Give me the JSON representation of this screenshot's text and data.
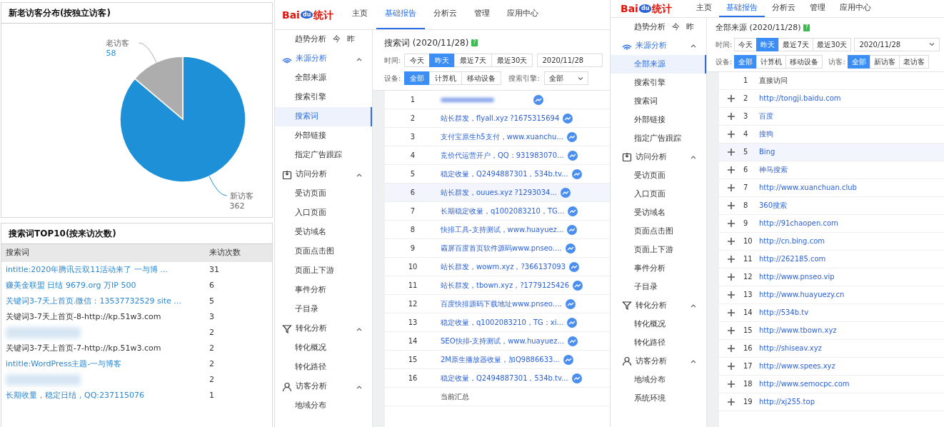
{
  "visitor_share": {
    "title": "新老访客分布(按独立访客)",
    "chart_data": {
      "type": "pie",
      "categories": [
        "老访客",
        "新访客"
      ],
      "values": [
        58,
        362
      ],
      "data_labels": true
    }
  },
  "keyword_top10": {
    "title": "搜索词TOP10(按来访次数)",
    "columns": [
      "搜索词",
      "来访次数"
    ],
    "rows": [
      {
        "kind": "link",
        "keyword": "intitle:2020年腾讯云双11活动来了 一与博 ...",
        "visits": "31"
      },
      {
        "kind": "link",
        "keyword": "赚美金联盟 日结 9679.org 万IP 500",
        "visits": "6"
      },
      {
        "kind": "link",
        "keyword": "关键词3-7天上首页.微信：13537732529 site ...",
        "visits": "5"
      },
      {
        "kind": "text",
        "keyword": "关键词3-7天上首页-8-http://kp.51w3.com",
        "visits": "3"
      },
      {
        "kind": "blurred",
        "visits": "2"
      },
      {
        "kind": "text",
        "keyword": "关键词3-7天上首页-7-http://kp.51w3.com",
        "visits": "2"
      },
      {
        "kind": "link",
        "keyword": "intitle:WordPress主题-一与博客",
        "visits": "2"
      },
      {
        "kind": "blurred",
        "visits": "2"
      },
      {
        "kind": "link",
        "keyword": "长期收量，稳定日结，QQ:237115076",
        "visits": "1"
      }
    ]
  },
  "reports": [
    {
      "logo": {
        "left": "Bai",
        "paw": "du",
        "right": "统计"
      },
      "nav": [
        {
          "label": "主页",
          "selected": false
        },
        {
          "label": "基础报告",
          "selected": true
        },
        {
          "label": "分析云",
          "selected": false
        },
        {
          "label": "管理",
          "selected": false
        },
        {
          "label": "应用中心",
          "selected": false
        }
      ],
      "sidebar": [
        {
          "kind": "link",
          "label": "趋势分析",
          "shortcuts": [
            "今",
            "昨"
          ]
        },
        {
          "kind": "section",
          "label": "来源分析",
          "expanded": true,
          "children": [
            {
              "label": "全部来源",
              "selected": false
            },
            {
              "label": "搜索引擎",
              "selected": false
            },
            {
              "label": "搜索词",
              "selected": true
            },
            {
              "label": "外部链接",
              "selected": false
            },
            {
              "label": "指定广告跟踪",
              "selected": false
            }
          ]
        },
        {
          "kind": "section",
          "label": "访问分析",
          "expanded": true,
          "children": [
            {
              "label": "受访页面",
              "selected": false
            },
            {
              "label": "入口页面",
              "selected": false
            },
            {
              "label": "受访域名",
              "selected": false
            },
            {
              "label": "页面点击图",
              "selected": false
            },
            {
              "label": "页面上下游",
              "selected": false
            },
            {
              "label": "事件分析",
              "selected": false
            },
            {
              "label": "子目录",
              "selected": false
            }
          ]
        },
        {
          "kind": "section",
          "label": "转化分析",
          "expanded": true,
          "children": [
            {
              "label": "转化概况",
              "selected": false
            },
            {
              "label": "转化路径",
              "selected": false
            }
          ]
        },
        {
          "kind": "section",
          "label": "访客分析",
          "expanded": true,
          "children": [
            {
              "label": "地域分布",
              "selected": false
            }
          ]
        }
      ],
      "title": "搜索词",
      "date": "(2020/11/28)",
      "help_mark": "?",
      "filters": [
        {
          "label": "时间:",
          "controls": [
            {
              "kind": "buttons",
              "options": [
                {
                  "label": "今天",
                  "selected": false
                },
                {
                  "label": "昨天",
                  "selected": true
                },
                {
                  "label": "最近7天",
                  "selected": false
                },
                {
                  "label": "最近30天",
                  "selected": false
                }
              ]
            },
            {
              "kind": "date",
              "value": "2020/11/28",
              "dropdown": false
            }
          ]
        },
        {
          "label": "设备:",
          "controls": [
            {
              "kind": "buttons",
              "options": [
                {
                  "label": "全部",
                  "selected": true
                },
                {
                  "label": "计算机",
                  "selected": false
                },
                {
                  "label": "移动设备",
                  "selected": false
                }
              ]
            },
            {
              "kind": "select",
              "label": "搜索引擎:",
              "value": "全部"
            }
          ]
        }
      ],
      "table": {
        "trend_icons": true,
        "summary": "当前汇总",
        "rows": [
          {
            "index": "1",
            "kind": "blurred",
            "hovered": false
          },
          {
            "index": "2",
            "kind": "link",
            "text": "站长群发，flyall.xyz ?1675315694",
            "hovered": false
          },
          {
            "index": "3",
            "kind": "link",
            "text": "支付宝原生h5支付，www.xuanchu...",
            "hovered": false
          },
          {
            "index": "4",
            "kind": "link",
            "text": "竞价代运营开户，QQ：931983070...",
            "hovered": false
          },
          {
            "index": "5",
            "kind": "link",
            "text": "稳定收量，Q2494887301，534b.tv...",
            "hovered": false
          },
          {
            "index": "6",
            "kind": "link",
            "text": "站长群发，ouues.xyz ?1293034...",
            "hovered": true
          },
          {
            "index": "7",
            "kind": "link",
            "text": "长期稳定收量，q1002083210，TG...",
            "hovered": false
          },
          {
            "index": "8",
            "kind": "link",
            "text": "快排工具-支持测试，www.huayuez...",
            "hovered": false
          },
          {
            "index": "9",
            "kind": "link",
            "text": "霸屏百度首页软件源码www.pnseo....",
            "hovered": false
          },
          {
            "index": "10",
            "kind": "link",
            "text": "站长群发，wowm.xyz，?366137093",
            "hovered": false
          },
          {
            "index": "11",
            "kind": "link",
            "text": "站长群发，tbown.xyz，?1779125426",
            "hovered": false
          },
          {
            "index": "12",
            "kind": "link",
            "text": "百度快排源码下载地址www.pnseo....",
            "hovered": false
          },
          {
            "index": "13",
            "kind": "link",
            "text": "稳定收量，q1002083210，TG：xi...",
            "hovered": false
          },
          {
            "index": "14",
            "kind": "link",
            "text": "SEO快排-支持测试，www.huayuez...",
            "hovered": false
          },
          {
            "index": "15",
            "kind": "link",
            "text": "2M原生播放器收量，加Q9886633...",
            "hovered": false
          },
          {
            "index": "16",
            "kind": "link",
            "text": "稳定收量，Q2494887301，534b.tv...",
            "hovered": false
          }
        ]
      }
    },
    {
      "logo": {
        "left": "Bai",
        "paw": "du",
        "right": "统计"
      },
      "nav": [
        {
          "label": "主页",
          "selected": false
        },
        {
          "label": "基础报告",
          "selected": true
        },
        {
          "label": "分析云",
          "selected": false
        },
        {
          "label": "管理",
          "selected": false
        },
        {
          "label": "应用中心",
          "selected": false
        }
      ],
      "sidebar": [
        {
          "kind": "link",
          "label": "趋势分析",
          "shortcuts": [
            "今",
            "昨"
          ]
        },
        {
          "kind": "section",
          "label": "来源分析",
          "expanded": true,
          "children": [
            {
              "label": "全部来源",
              "selected": true
            },
            {
              "label": "搜索引擎",
              "selected": false
            },
            {
              "label": "搜索词",
              "selected": false
            },
            {
              "label": "外部链接",
              "selected": false
            },
            {
              "label": "指定广告跟踪",
              "selected": false
            }
          ]
        },
        {
          "kind": "section",
          "label": "访问分析",
          "expanded": true,
          "children": [
            {
              "label": "受访页面",
              "selected": false
            },
            {
              "label": "入口页面",
              "selected": false
            },
            {
              "label": "受访域名",
              "selected": false
            },
            {
              "label": "页面点击图",
              "selected": false
            },
            {
              "label": "页面上下游",
              "selected": false
            },
            {
              "label": "事件分析",
              "selected": false
            },
            {
              "label": "子目录",
              "selected": false
            }
          ]
        },
        {
          "kind": "section",
          "label": "转化分析",
          "expanded": true,
          "children": [
            {
              "label": "转化概况",
              "selected": false
            },
            {
              "label": "转化路径",
              "selected": false
            }
          ]
        },
        {
          "kind": "section",
          "label": "访客分析",
          "expanded": true,
          "children": [
            {
              "label": "地域分布",
              "selected": false
            },
            {
              "label": "系统环境",
              "selected": false
            }
          ]
        }
      ],
      "title": "全部来源",
      "date": "(2020/11/28)",
      "help_mark": "?",
      "filters": [
        {
          "label": "时间:",
          "controls": [
            {
              "kind": "buttons",
              "options": [
                {
                  "label": "今天",
                  "selected": false
                },
                {
                  "label": "昨天",
                  "selected": true
                },
                {
                  "label": "最近7天",
                  "selected": false
                },
                {
                  "label": "最近30天",
                  "selected": false
                }
              ]
            },
            {
              "kind": "date",
              "value": "2020/11/28",
              "dropdown": true
            }
          ]
        },
        {
          "label": "设备:",
          "controls": [
            {
              "kind": "buttons",
              "options": [
                {
                  "label": "全部",
                  "selected": true
                },
                {
                  "label": "计算机",
                  "selected": false
                },
                {
                  "label": "移动设备",
                  "selected": false
                }
              ]
            },
            {
              "kind": "buttons",
              "label": "访客:",
              "options": [
                {
                  "label": "全部",
                  "selected": true
                },
                {
                  "label": "新访客",
                  "selected": false
                },
                {
                  "label": "老访客",
                  "selected": false
                }
              ]
            }
          ]
        }
      ],
      "table": {
        "rows": [
          {
            "index": "1",
            "kind": "text",
            "text": "直接访问",
            "expandable": false,
            "hovered": false
          },
          {
            "index": "2",
            "kind": "link",
            "text": "http://tongji.baidu.com",
            "expandable": true,
            "hovered": false
          },
          {
            "index": "3",
            "kind": "link",
            "text": "百度",
            "expandable": true,
            "hovered": false
          },
          {
            "index": "4",
            "kind": "link",
            "text": "搜狗",
            "expandable": true,
            "hovered": false
          },
          {
            "index": "5",
            "kind": "link",
            "text": "Bing",
            "expandable": true,
            "hovered": true
          },
          {
            "index": "6",
            "kind": "link",
            "text": "神马搜索",
            "expandable": true,
            "hovered": false
          },
          {
            "index": "7",
            "kind": "link",
            "text": "http://www.xuanchuan.club",
            "expandable": true,
            "hovered": false
          },
          {
            "index": "8",
            "kind": "link",
            "text": "360搜索",
            "expandable": true,
            "hovered": false
          },
          {
            "index": "9",
            "kind": "link",
            "text": "http://91chaopen.com",
            "expandable": true,
            "hovered": false
          },
          {
            "index": "10",
            "kind": "link",
            "text": "http://cn.bing.com",
            "expandable": true,
            "hovered": false
          },
          {
            "index": "11",
            "kind": "link",
            "text": "http://262185.com",
            "expandable": true,
            "hovered": false
          },
          {
            "index": "12",
            "kind": "link",
            "text": "http://www.pnseo.vip",
            "expandable": true,
            "hovered": false
          },
          {
            "index": "13",
            "kind": "link",
            "text": "http://www.huayuezy.cn",
            "expandable": true,
            "hovered": false
          },
          {
            "index": "14",
            "kind": "link",
            "text": "http://534b.tv",
            "expandable": true,
            "hovered": false
          },
          {
            "index": "15",
            "kind": "link",
            "text": "http://www.tbown.xyz",
            "expandable": true,
            "hovered": false
          },
          {
            "index": "16",
            "kind": "link",
            "text": "http://shiseav.xyz",
            "expandable": true,
            "hovered": false
          },
          {
            "index": "17",
            "kind": "link",
            "text": "http://www.spees.xyz",
            "expandable": true,
            "hovered": false
          },
          {
            "index": "18",
            "kind": "link",
            "text": "http://www.semocpc.com",
            "expandable": true,
            "hovered": false
          },
          {
            "index": "19",
            "kind": "link",
            "text": "http://xj255.top",
            "expandable": true,
            "hovered": false
          }
        ]
      }
    }
  ]
}
